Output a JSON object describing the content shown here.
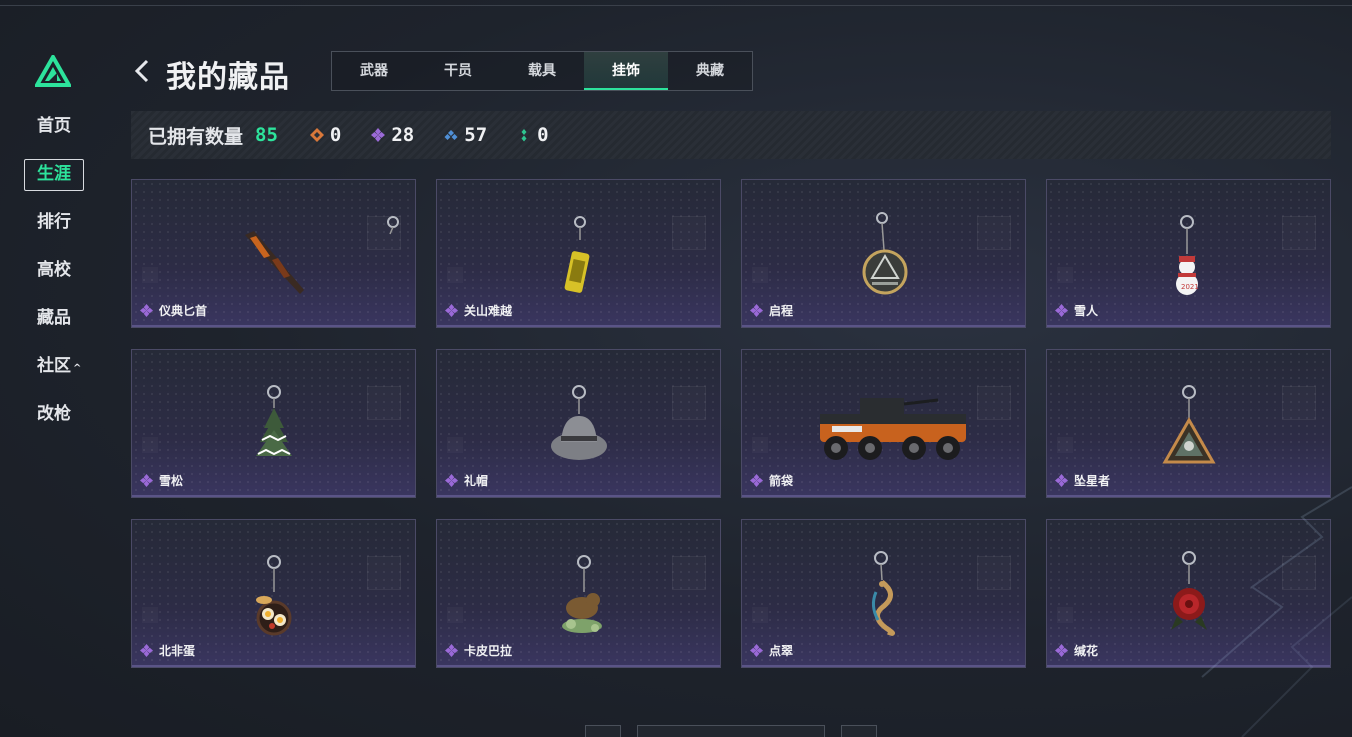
{
  "sidebar": {
    "items": [
      {
        "label": "首页",
        "active": false
      },
      {
        "label": "生涯",
        "active": true
      },
      {
        "label": "排行",
        "active": false
      },
      {
        "label": "高校",
        "active": false
      },
      {
        "label": "藏品",
        "active": false
      },
      {
        "label": "社区",
        "active": false,
        "caret": "^"
      },
      {
        "label": "改枪",
        "active": false
      }
    ]
  },
  "header": {
    "title": "我的藏品",
    "tabs": [
      {
        "label": "武器",
        "active": false
      },
      {
        "label": "干员",
        "active": false
      },
      {
        "label": "载具",
        "active": false
      },
      {
        "label": "挂饰",
        "active": true
      },
      {
        "label": "典藏",
        "active": false
      }
    ]
  },
  "summary": {
    "label": "已拥有数量",
    "total": "85",
    "stats": [
      {
        "icon": "orange-diamond-icon",
        "color": "#d9783a",
        "value": "0"
      },
      {
        "icon": "purple-diamond-icon",
        "color": "#9b6ad8",
        "value": "28"
      },
      {
        "icon": "blue-diamond-icon",
        "color": "#4f8fd6",
        "value": "57"
      },
      {
        "icon": "green-diamond-icon",
        "color": "#2ec48f",
        "value": "0"
      }
    ]
  },
  "items": [
    {
      "name": "仪典匕首",
      "icon": "dagger-charm-icon"
    },
    {
      "name": "关山难越",
      "icon": "can-charm-icon"
    },
    {
      "name": "启程",
      "icon": "medal-charm-icon"
    },
    {
      "name": "雪人",
      "icon": "snowman-charm-icon"
    },
    {
      "name": "雪松",
      "icon": "pine-tree-charm-icon"
    },
    {
      "name": "礼帽",
      "icon": "hat-charm-icon"
    },
    {
      "name": "箭袋",
      "icon": "armored-vehicle-icon"
    },
    {
      "name": "坠星者",
      "icon": "triangle-badge-charm-icon"
    },
    {
      "name": "北非蛋",
      "icon": "skillet-charm-icon"
    },
    {
      "name": "卡皮巴拉",
      "icon": "capybara-charm-icon"
    },
    {
      "name": "点翠",
      "icon": "phoenix-charm-icon"
    },
    {
      "name": "缄花",
      "icon": "rose-charm-icon"
    }
  ],
  "colors": {
    "accent": "#2de39c",
    "rarity_purple": "#9b6ad8"
  }
}
